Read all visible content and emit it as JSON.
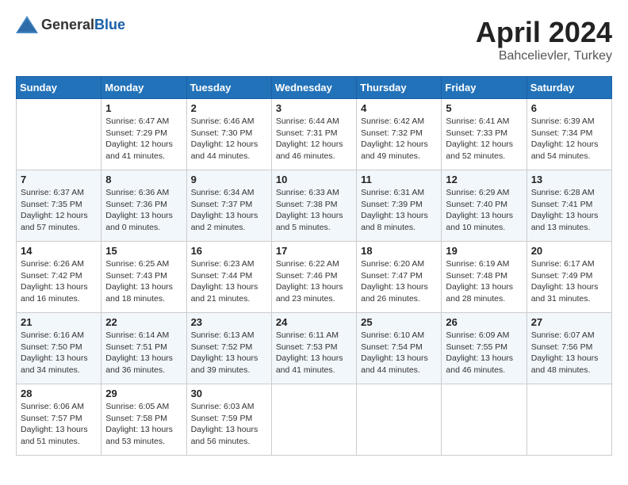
{
  "header": {
    "logo_general": "General",
    "logo_blue": "Blue",
    "title": "April 2024",
    "location": "Bahcelievler, Turkey"
  },
  "calendar": {
    "days_of_week": [
      "Sunday",
      "Monday",
      "Tuesday",
      "Wednesday",
      "Thursday",
      "Friday",
      "Saturday"
    ],
    "weeks": [
      [
        {
          "day": "",
          "sunrise": "",
          "sunset": "",
          "daylight": ""
        },
        {
          "day": "1",
          "sunrise": "Sunrise: 6:47 AM",
          "sunset": "Sunset: 7:29 PM",
          "daylight": "Daylight: 12 hours and 41 minutes."
        },
        {
          "day": "2",
          "sunrise": "Sunrise: 6:46 AM",
          "sunset": "Sunset: 7:30 PM",
          "daylight": "Daylight: 12 hours and 44 minutes."
        },
        {
          "day": "3",
          "sunrise": "Sunrise: 6:44 AM",
          "sunset": "Sunset: 7:31 PM",
          "daylight": "Daylight: 12 hours and 46 minutes."
        },
        {
          "day": "4",
          "sunrise": "Sunrise: 6:42 AM",
          "sunset": "Sunset: 7:32 PM",
          "daylight": "Daylight: 12 hours and 49 minutes."
        },
        {
          "day": "5",
          "sunrise": "Sunrise: 6:41 AM",
          "sunset": "Sunset: 7:33 PM",
          "daylight": "Daylight: 12 hours and 52 minutes."
        },
        {
          "day": "6",
          "sunrise": "Sunrise: 6:39 AM",
          "sunset": "Sunset: 7:34 PM",
          "daylight": "Daylight: 12 hours and 54 minutes."
        }
      ],
      [
        {
          "day": "7",
          "sunrise": "Sunrise: 6:37 AM",
          "sunset": "Sunset: 7:35 PM",
          "daylight": "Daylight: 12 hours and 57 minutes."
        },
        {
          "day": "8",
          "sunrise": "Sunrise: 6:36 AM",
          "sunset": "Sunset: 7:36 PM",
          "daylight": "Daylight: 13 hours and 0 minutes."
        },
        {
          "day": "9",
          "sunrise": "Sunrise: 6:34 AM",
          "sunset": "Sunset: 7:37 PM",
          "daylight": "Daylight: 13 hours and 2 minutes."
        },
        {
          "day": "10",
          "sunrise": "Sunrise: 6:33 AM",
          "sunset": "Sunset: 7:38 PM",
          "daylight": "Daylight: 13 hours and 5 minutes."
        },
        {
          "day": "11",
          "sunrise": "Sunrise: 6:31 AM",
          "sunset": "Sunset: 7:39 PM",
          "daylight": "Daylight: 13 hours and 8 minutes."
        },
        {
          "day": "12",
          "sunrise": "Sunrise: 6:29 AM",
          "sunset": "Sunset: 7:40 PM",
          "daylight": "Daylight: 13 hours and 10 minutes."
        },
        {
          "day": "13",
          "sunrise": "Sunrise: 6:28 AM",
          "sunset": "Sunset: 7:41 PM",
          "daylight": "Daylight: 13 hours and 13 minutes."
        }
      ],
      [
        {
          "day": "14",
          "sunrise": "Sunrise: 6:26 AM",
          "sunset": "Sunset: 7:42 PM",
          "daylight": "Daylight: 13 hours and 16 minutes."
        },
        {
          "day": "15",
          "sunrise": "Sunrise: 6:25 AM",
          "sunset": "Sunset: 7:43 PM",
          "daylight": "Daylight: 13 hours and 18 minutes."
        },
        {
          "day": "16",
          "sunrise": "Sunrise: 6:23 AM",
          "sunset": "Sunset: 7:44 PM",
          "daylight": "Daylight: 13 hours and 21 minutes."
        },
        {
          "day": "17",
          "sunrise": "Sunrise: 6:22 AM",
          "sunset": "Sunset: 7:46 PM",
          "daylight": "Daylight: 13 hours and 23 minutes."
        },
        {
          "day": "18",
          "sunrise": "Sunrise: 6:20 AM",
          "sunset": "Sunset: 7:47 PM",
          "daylight": "Daylight: 13 hours and 26 minutes."
        },
        {
          "day": "19",
          "sunrise": "Sunrise: 6:19 AM",
          "sunset": "Sunset: 7:48 PM",
          "daylight": "Daylight: 13 hours and 28 minutes."
        },
        {
          "day": "20",
          "sunrise": "Sunrise: 6:17 AM",
          "sunset": "Sunset: 7:49 PM",
          "daylight": "Daylight: 13 hours and 31 minutes."
        }
      ],
      [
        {
          "day": "21",
          "sunrise": "Sunrise: 6:16 AM",
          "sunset": "Sunset: 7:50 PM",
          "daylight": "Daylight: 13 hours and 34 minutes."
        },
        {
          "day": "22",
          "sunrise": "Sunrise: 6:14 AM",
          "sunset": "Sunset: 7:51 PM",
          "daylight": "Daylight: 13 hours and 36 minutes."
        },
        {
          "day": "23",
          "sunrise": "Sunrise: 6:13 AM",
          "sunset": "Sunset: 7:52 PM",
          "daylight": "Daylight: 13 hours and 39 minutes."
        },
        {
          "day": "24",
          "sunrise": "Sunrise: 6:11 AM",
          "sunset": "Sunset: 7:53 PM",
          "daylight": "Daylight: 13 hours and 41 minutes."
        },
        {
          "day": "25",
          "sunrise": "Sunrise: 6:10 AM",
          "sunset": "Sunset: 7:54 PM",
          "daylight": "Daylight: 13 hours and 44 minutes."
        },
        {
          "day": "26",
          "sunrise": "Sunrise: 6:09 AM",
          "sunset": "Sunset: 7:55 PM",
          "daylight": "Daylight: 13 hours and 46 minutes."
        },
        {
          "day": "27",
          "sunrise": "Sunrise: 6:07 AM",
          "sunset": "Sunset: 7:56 PM",
          "daylight": "Daylight: 13 hours and 48 minutes."
        }
      ],
      [
        {
          "day": "28",
          "sunrise": "Sunrise: 6:06 AM",
          "sunset": "Sunset: 7:57 PM",
          "daylight": "Daylight: 13 hours and 51 minutes."
        },
        {
          "day": "29",
          "sunrise": "Sunrise: 6:05 AM",
          "sunset": "Sunset: 7:58 PM",
          "daylight": "Daylight: 13 hours and 53 minutes."
        },
        {
          "day": "30",
          "sunrise": "Sunrise: 6:03 AM",
          "sunset": "Sunset: 7:59 PM",
          "daylight": "Daylight: 13 hours and 56 minutes."
        },
        {
          "day": "",
          "sunrise": "",
          "sunset": "",
          "daylight": ""
        },
        {
          "day": "",
          "sunrise": "",
          "sunset": "",
          "daylight": ""
        },
        {
          "day": "",
          "sunrise": "",
          "sunset": "",
          "daylight": ""
        },
        {
          "day": "",
          "sunrise": "",
          "sunset": "",
          "daylight": ""
        }
      ]
    ]
  }
}
